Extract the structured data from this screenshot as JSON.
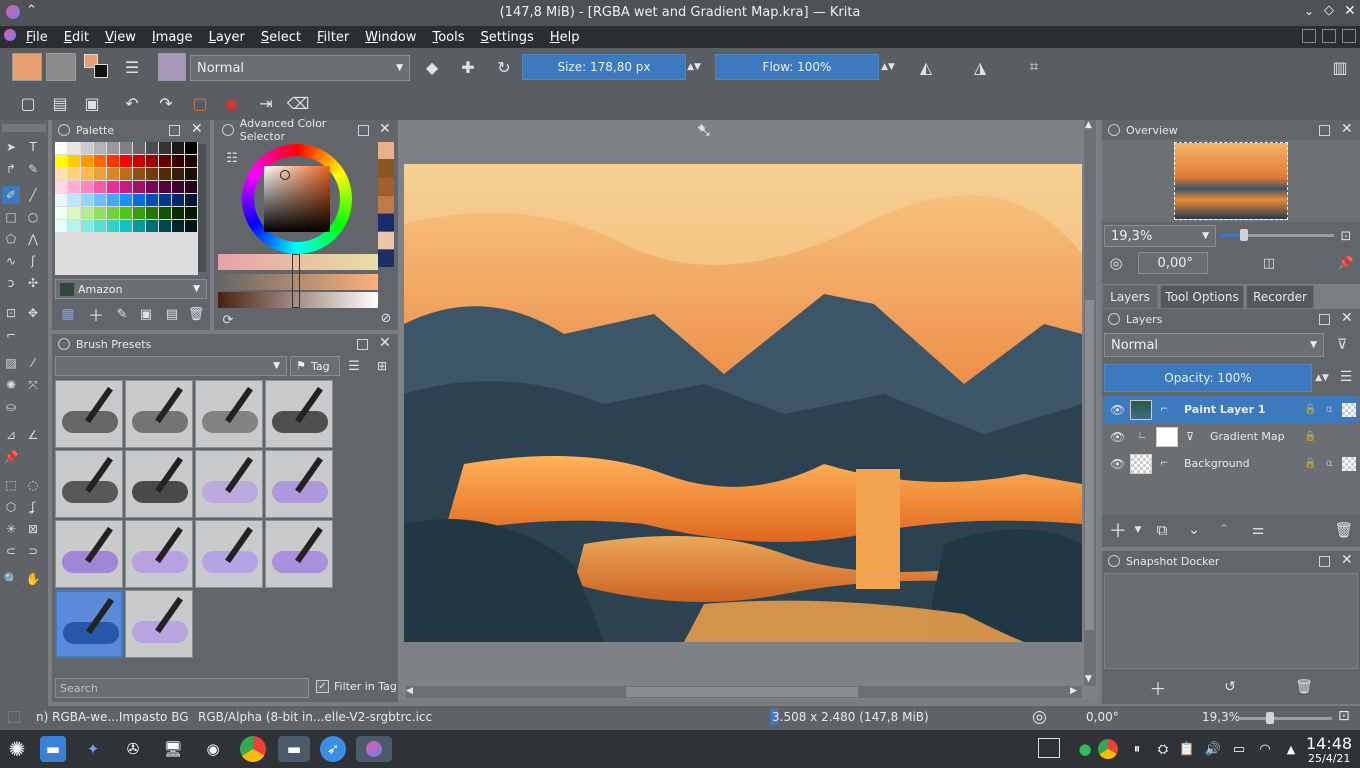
{
  "window": {
    "title": "(147,8 MiB) - [RGBA wet and Gradient Map.kra] — Krita"
  },
  "menu": [
    "File",
    "Edit",
    "View",
    "Image",
    "Layer",
    "Select",
    "Filter",
    "Window",
    "Tools",
    "Settings",
    "Help"
  ],
  "toolbar": {
    "blend_mode": "Normal",
    "size_label": "Size: 178,80 px",
    "flow_label": "Flow: 100%"
  },
  "palette": {
    "title": "Palette",
    "palette_name": "Amazon",
    "colors": [
      "#ffffff",
      "#e6e6e6",
      "#cccccc",
      "#b3b3b3",
      "#999999",
      "#808080",
      "#666666",
      "#4d4d4d",
      "#333333",
      "#1a1a1a",
      "#000000",
      "#ffff00",
      "#ffcc00",
      "#ff9900",
      "#ff6600",
      "#ff3300",
      "#ff0000",
      "#cc0000",
      "#990000",
      "#660000",
      "#330000",
      "#1a0000",
      "#ffe0b3",
      "#ffd180",
      "#ffb84d",
      "#e6a23c",
      "#d4882a",
      "#b86e1f",
      "#8c5216",
      "#6b3e10",
      "#4d2c0b",
      "#33200a",
      "#1a1005",
      "#ffd6e7",
      "#ffadd2",
      "#ff85c0",
      "#f759ab",
      "#eb2f96",
      "#c41d7f",
      "#9e1068",
      "#780650",
      "#520339",
      "#3d0229",
      "#26011a",
      "#e6f7ff",
      "#bae7ff",
      "#91d5ff",
      "#69c0ff",
      "#40a9ff",
      "#1890ff",
      "#096dd9",
      "#0050b3",
      "#003a8c",
      "#002766",
      "#001433",
      "#f0fff0",
      "#d9f7be",
      "#b7eb8f",
      "#95de64",
      "#73d13d",
      "#52c41a",
      "#389e0d",
      "#237804",
      "#135200",
      "#092b00",
      "#041a00",
      "#e6fffb",
      "#b5f5ec",
      "#87e8de",
      "#5cdbd3",
      "#36cfc9",
      "#13c2c2",
      "#08979c",
      "#006d75",
      "#00474f",
      "#002329",
      "#00151a"
    ]
  },
  "color_selector": {
    "title": "Advanced Color Selector",
    "history": [
      "#e9b08a",
      "#8b5523",
      "#a0602d",
      "#c07a48",
      "#1e2a6e",
      "#ebc5a8",
      "#1c2f66"
    ]
  },
  "brush_presets": {
    "title": "Brush Presets",
    "tag_label": "Tag",
    "search_placeholder": "Search",
    "filter_label": "Filter in Tag"
  },
  "overview": {
    "title": "Overview",
    "zoom": "19,3%",
    "rotation": "0,00°"
  },
  "tabs": [
    "Layers",
    "Tool Options",
    "Recorder"
  ],
  "layers": {
    "title": "Layers",
    "blend_mode": "Normal",
    "opacity_label": "Opacity:  100%",
    "items": [
      {
        "name": "Paint Layer 1",
        "selected": true
      },
      {
        "name": "Gradient Map",
        "selected": false
      },
      {
        "name": "Background",
        "selected": false
      }
    ]
  },
  "snapshot": {
    "title": "Snapshot Docker"
  },
  "status": {
    "brush": "n) RGBA-we...Impasto BG",
    "colorspace": "RGB/Alpha (8-bit in...elle-V2-srgbtrc.icc",
    "dimensions": "3.508 x 2.480 (147,8 MiB)",
    "rotation": "0,00°",
    "zoom": "19,3%"
  },
  "clock": {
    "time": "14:48",
    "date": "25/4/21"
  }
}
